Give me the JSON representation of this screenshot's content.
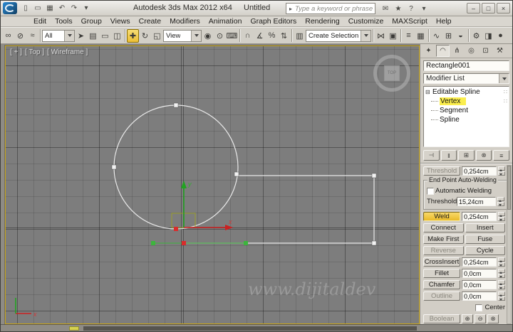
{
  "titlebar": {
    "app_title": "Autodesk 3ds Max 2012 x64",
    "doc_title": "Untitled",
    "search_placeholder": "Type a keyword or phrase",
    "search_arrow": "▸",
    "quick_icons": [
      {
        "name": "new-file-icon",
        "glyph": "▯"
      },
      {
        "name": "open-file-icon",
        "glyph": "▭"
      },
      {
        "name": "save-icon",
        "glyph": "▦"
      },
      {
        "name": "undo-icon",
        "glyph": "↶"
      },
      {
        "name": "redo-icon",
        "glyph": "↷"
      },
      {
        "name": "toolbar-options-icon",
        "glyph": "▾"
      }
    ],
    "right_icons": [
      {
        "name": "communication-center-icon",
        "glyph": "✉"
      },
      {
        "name": "favorites-icon",
        "glyph": "★"
      },
      {
        "name": "help-icon",
        "glyph": "?"
      },
      {
        "name": "help-dropdown-icon",
        "glyph": "▾"
      }
    ],
    "window_controls": [
      {
        "name": "minimize-button",
        "glyph": "–"
      },
      {
        "name": "maximize-button",
        "glyph": "□"
      },
      {
        "name": "close-button",
        "glyph": "×"
      }
    ]
  },
  "menubar": {
    "items": [
      "Edit",
      "Tools",
      "Group",
      "Views",
      "Create",
      "Modifiers",
      "Animation",
      "Graph Editors",
      "Rendering",
      "Customize",
      "MAXScript",
      "Help"
    ]
  },
  "toolbar": {
    "filter_value": "All",
    "coord_value": "View",
    "selection_set_value": "Create Selection Se",
    "icons": [
      {
        "name": "select-and-link-icon",
        "glyph": "∞"
      },
      {
        "name": "unlink-selection-icon",
        "glyph": "⊘"
      },
      {
        "name": "bind-to-spacewarp-icon",
        "glyph": "≈"
      },
      {
        "name": "select-object-icon",
        "glyph": "➤"
      },
      {
        "name": "select-by-name-icon",
        "glyph": "▤"
      },
      {
        "name": "rectangular-selection-icon",
        "glyph": "▭"
      },
      {
        "name": "window-crossing-icon",
        "glyph": "◫"
      },
      {
        "name": "select-and-move-icon",
        "glyph": "✚"
      },
      {
        "name": "select-and-rotate-icon",
        "glyph": "↻"
      },
      {
        "name": "select-and-scale-icon",
        "glyph": "◱"
      },
      {
        "name": "use-pivot-point-center-icon",
        "glyph": "◉"
      },
      {
        "name": "select-and-manipulate-icon",
        "glyph": "⊙"
      },
      {
        "name": "keyboard-override-icon",
        "glyph": "⌨"
      },
      {
        "name": "snaps-toggle-icon",
        "glyph": "∩"
      },
      {
        "name": "angle-snap-icon",
        "glyph": "∡"
      },
      {
        "name": "percent-snap-icon",
        "glyph": "%"
      },
      {
        "name": "spinner-snap-icon",
        "glyph": "⇅"
      },
      {
        "name": "named-selection-sets-icon",
        "glyph": "▥"
      },
      {
        "name": "mirror-icon",
        "glyph": "⋈"
      },
      {
        "name": "align-icon",
        "glyph": "▣"
      },
      {
        "name": "layer-manager-icon",
        "glyph": "≡"
      },
      {
        "name": "ribbon-toggle-icon",
        "glyph": "▦"
      },
      {
        "name": "curve-editor-icon",
        "glyph": "∿"
      },
      {
        "name": "schematic-view-icon",
        "glyph": "⊞"
      },
      {
        "name": "material-editor-icon",
        "glyph": "◒"
      },
      {
        "name": "render-setup-icon",
        "glyph": "⚙"
      },
      {
        "name": "rendered-frame-icon",
        "glyph": "◨"
      },
      {
        "name": "render-production-icon",
        "glyph": "●"
      }
    ]
  },
  "viewport": {
    "label_plus": "[ + ]",
    "label_view": "[ Top ]",
    "label_shading": "[ Wireframe ]",
    "viewcube_label": "TOP",
    "axis_x_label": "x",
    "axis_y_label": "y",
    "watermark": "www.dijitaldev"
  },
  "panel": {
    "tabs": [
      {
        "name": "create",
        "glyph": "✦"
      },
      {
        "name": "modify",
        "glyph": "◠"
      },
      {
        "name": "hierarchy",
        "glyph": "⋔"
      },
      {
        "name": "motion",
        "glyph": "◎"
      },
      {
        "name": "display",
        "glyph": "⊡"
      },
      {
        "name": "utilities",
        "glyph": "⚒"
      }
    ],
    "object_name": "Rectangle001",
    "modifier_list_label": "Modifier List",
    "stack": {
      "root_toggle": "⊟",
      "root_label": "Editable Spline",
      "grip": "∷",
      "items": [
        {
          "label": "Vertex"
        },
        {
          "label": "Segment"
        },
        {
          "label": "Spline"
        }
      ]
    },
    "stack_toolbar": [
      {
        "name": "pin-stack-icon",
        "glyph": "⊣"
      },
      {
        "name": "show-end-result-icon",
        "glyph": "‖"
      },
      {
        "name": "make-unique-icon",
        "glyph": "⊞"
      },
      {
        "name": "remove-modifier-icon",
        "glyph": "⊗"
      },
      {
        "name": "configure-modifier-sets-icon",
        "glyph": "≡"
      }
    ],
    "rollout": {
      "connect_threshold_label": "Threshold",
      "connect_threshold_value": "0,254cm",
      "group_title": "End Point Auto-Welding",
      "automatic_welding_label": "Automatic Welding",
      "weld_threshold_label": "Threshold",
      "weld_threshold_value": "15,24cm",
      "weld_label": "Weld",
      "weld_value": "0,254cm",
      "connect_label": "Connect",
      "insert_label": "Insert",
      "make_first_label": "Make First",
      "fuse_label": "Fuse",
      "reverse_label": "Reverse",
      "cycle_label": "Cycle",
      "cross_insert_label": "CrossInsert",
      "cross_insert_value": "0,254cm",
      "fillet_label": "Fillet",
      "fillet_value": "0,0cm",
      "chamfer_label": "Chamfer",
      "chamfer_value": "0,0cm",
      "outline_label": "Outline",
      "outline_value": "0,0cm",
      "center_label": "Center",
      "boolean_label": "Boolean",
      "boolean_icons": [
        {
          "name": "boolean-union-icon",
          "glyph": "⊕"
        },
        {
          "name": "boolean-subtract-icon",
          "glyph": "⊖"
        },
        {
          "name": "boolean-intersect-icon",
          "glyph": "⊗"
        }
      ]
    }
  }
}
